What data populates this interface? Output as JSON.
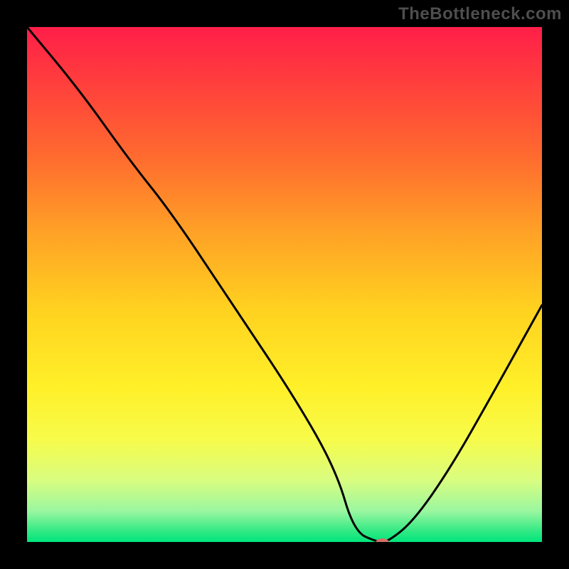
{
  "watermark": "TheBottleneck.com",
  "chart_data": {
    "type": "line",
    "title": "",
    "xlabel": "",
    "ylabel": "",
    "xlim": [
      0,
      100
    ],
    "ylim": [
      0,
      100
    ],
    "grid": false,
    "legend": false,
    "series": [
      {
        "name": "bottleneck-curve",
        "x": [
          0,
          10,
          20,
          28,
          40,
          52,
          60,
          63.5,
          68,
          70,
          75,
          82,
          90,
          100
        ],
        "y": [
          100,
          88,
          74,
          64,
          46,
          28,
          14,
          2,
          0,
          0,
          4,
          14,
          28,
          46
        ]
      }
    ],
    "marker": {
      "name": "current-position",
      "x": 69,
      "y": 0,
      "color": "#d76e66",
      "rx": 9,
      "ry": 5
    },
    "background_gradient": {
      "stops": [
        {
          "offset": 0.0,
          "color": "#ff1e49"
        },
        {
          "offset": 0.1,
          "color": "#ff3c3d"
        },
        {
          "offset": 0.25,
          "color": "#ff6a2f"
        },
        {
          "offset": 0.4,
          "color": "#ffa226"
        },
        {
          "offset": 0.55,
          "color": "#ffd21f"
        },
        {
          "offset": 0.7,
          "color": "#fff029"
        },
        {
          "offset": 0.8,
          "color": "#f7fb4a"
        },
        {
          "offset": 0.88,
          "color": "#d9fd80"
        },
        {
          "offset": 0.94,
          "color": "#9af7a0"
        },
        {
          "offset": 0.98,
          "color": "#2fe983"
        },
        {
          "offset": 1.0,
          "color": "#00e57c"
        }
      ]
    },
    "line_color": "#000000",
    "line_width": 3
  }
}
